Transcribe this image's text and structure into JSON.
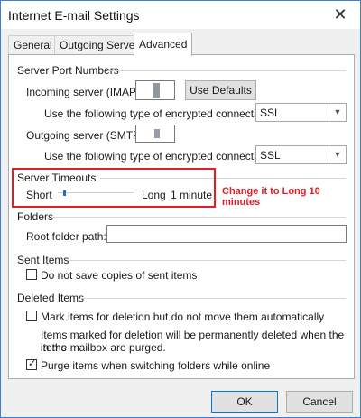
{
  "window": {
    "title": "Internet E-mail Settings"
  },
  "tabs": [
    {
      "label": "General"
    },
    {
      "label": "Outgoing Server"
    },
    {
      "label": "Advanced",
      "active": true
    }
  ],
  "server_ports": {
    "title": "Server Port Numbers",
    "incoming_label": "Incoming server (IMAP):",
    "use_defaults": "Use Defaults",
    "incoming_enc_label": "Use the following type of encrypted connection:",
    "incoming_enc_value": "SSL",
    "outgoing_label": "Outgoing server (SMTP):",
    "outgoing_enc_label": "Use the following type of encrypted connection:",
    "outgoing_enc_value": "SSL"
  },
  "server_timeouts": {
    "title": "Server Timeouts",
    "short_label": "Short",
    "long_label": "Long",
    "value_text": "1 minute",
    "slider_fraction": 0.07
  },
  "annotation": {
    "text": "Change it to Long  10 minutes",
    "color": "#e11d23"
  },
  "folders": {
    "title": "Folders",
    "root_label": "Root folder path:"
  },
  "sent_items": {
    "title": "Sent Items",
    "dont_save_label": "Do not save copies of sent items",
    "dont_save_checked": false
  },
  "deleted_items": {
    "title": "Deleted Items",
    "mark_label": "Mark items for deletion but do not move them automatically",
    "mark_checked": false,
    "note_line1": "Items marked for deletion will be permanently deleted when the items",
    "note_line2": "in the mailbox are purged.",
    "purge_label": "Purge items when switching folders while online",
    "purge_checked": true
  },
  "buttons": {
    "ok": "OK",
    "cancel": "Cancel"
  },
  "icons": {
    "close": "close-icon",
    "dropdown": "chevron-down-icon",
    "checkmark": "checkmark-icon"
  },
  "colors": {
    "accent": "#0078d7",
    "annotation": "#e11d23"
  }
}
